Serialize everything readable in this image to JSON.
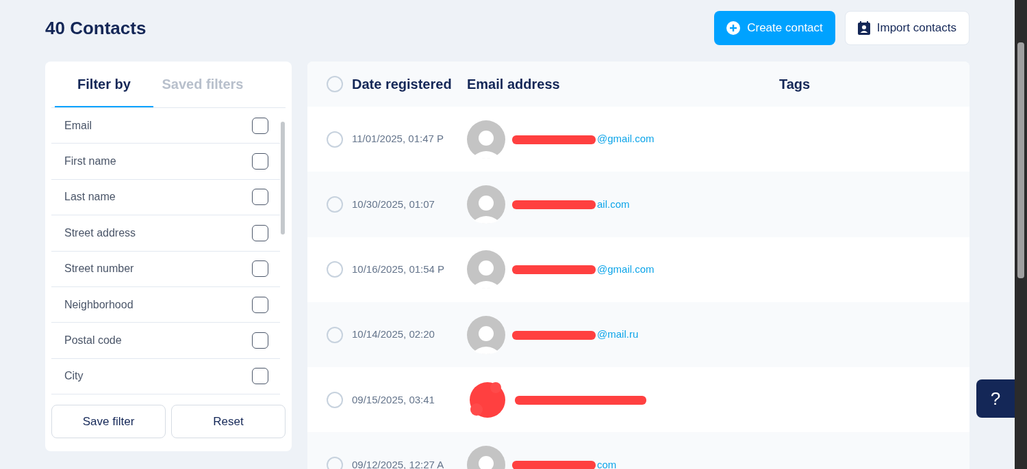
{
  "title": "40 Contacts",
  "actions": [
    {
      "kind": "primary",
      "label": "Create contact"
    },
    {
      "kind": "secondary",
      "label": "Import contacts"
    }
  ],
  "filter_tabs": [
    {
      "label": "Filter by",
      "selected": true
    },
    {
      "label": "Saved filters",
      "selected": false
    }
  ],
  "filters": [
    {
      "label": "Email",
      "checked": false
    },
    {
      "label": "First name",
      "checked": false
    },
    {
      "label": "Last name",
      "checked": false
    },
    {
      "label": "Street address",
      "checked": false
    },
    {
      "label": "Street number",
      "checked": false
    },
    {
      "label": "Neighborhood",
      "checked": false
    },
    {
      "label": "Postal code",
      "checked": false
    },
    {
      "label": "City",
      "checked": false
    }
  ],
  "filter_buttons": [
    "Save filter",
    "Reset"
  ],
  "table": {
    "columns": [
      "Date registered",
      "Email address",
      "Tags"
    ],
    "all_selected": false,
    "rows": [
      {
        "selected": false,
        "date": "11/01/2025, 01:47 P",
        "kind": "avatar",
        "email_visible": "@gmail.com"
      },
      {
        "selected": false,
        "date": "10/30/2025, 01:07",
        "kind": "avatar",
        "email_visible": "ail.com"
      },
      {
        "selected": false,
        "date": "10/16/2025, 01:54 P",
        "kind": "avatar",
        "email_visible": "@gmail.com"
      },
      {
        "selected": false,
        "date": "10/14/2025, 02:20",
        "kind": "avatar",
        "email_visible": "@mail.ru"
      },
      {
        "selected": false,
        "date": "09/15/2025, 03:41",
        "kind": "redacted"
      },
      {
        "selected": false,
        "date": "09/12/2025, 12:27 A",
        "kind": "avatar",
        "email_visible": "com"
      }
    ]
  },
  "help_button": "?"
}
